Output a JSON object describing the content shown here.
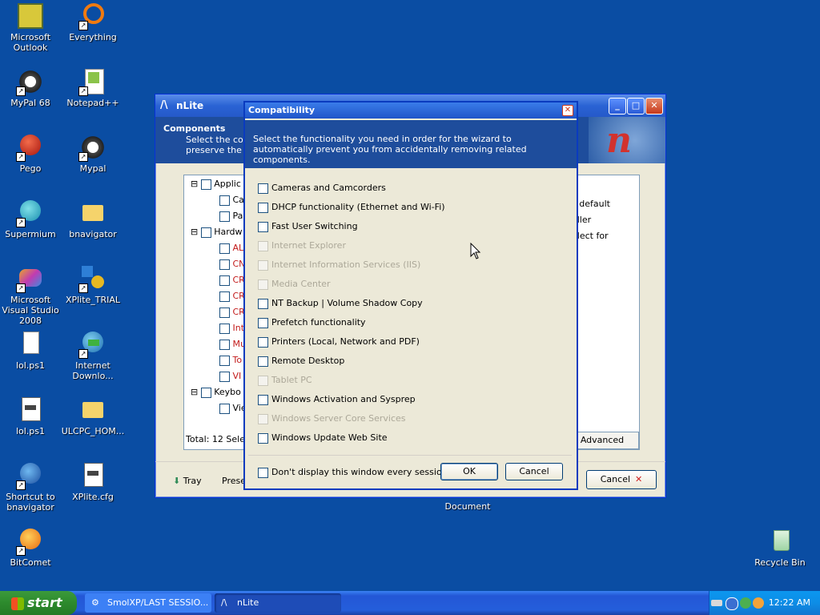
{
  "desktop": {
    "icons": [
      {
        "label": "Microsoft Outlook",
        "icon": "outlook-icon"
      },
      {
        "label": "Everything",
        "icon": "everything-icon"
      },
      {
        "label": "MyPal 68",
        "icon": "mypal-icon"
      },
      {
        "label": "Notepad++",
        "icon": "notepadpp-icon"
      },
      {
        "label": "Pego",
        "icon": "pego-icon"
      },
      {
        "label": "Mypal",
        "icon": "mypal-icon"
      },
      {
        "label": "Supermium",
        "icon": "supermium-icon"
      },
      {
        "label": "bnavigator",
        "icon": "folder-icon"
      },
      {
        "label": "Microsoft Visual Studio 2008",
        "icon": "visual-studio-icon"
      },
      {
        "label": "XPlite_TRIAL",
        "icon": "xplite-icon"
      },
      {
        "label": "lol.ps1",
        "icon": "text-file-icon"
      },
      {
        "label": "Internet Downlo...",
        "icon": "idm-icon"
      },
      {
        "label": "lol.ps1",
        "icon": "script-file-icon"
      },
      {
        "label": "ULCPC_HOM...",
        "icon": "folder-icon"
      },
      {
        "label": "Shortcut to bnavigator",
        "icon": "globe-icon"
      },
      {
        "label": "XPlite.cfg",
        "icon": "config-file-icon"
      },
      {
        "label": "BitComet",
        "icon": "bitcomet-icon"
      },
      {
        "label": "Recycle Bin",
        "icon": "recycle-bin-icon"
      }
    ],
    "hidden_label": "Document"
  },
  "nlite": {
    "title": "nLite",
    "header_title": "Components",
    "header_sub1": "Select the com",
    "header_sub2": "preserve the ch",
    "right_text1": "s default",
    "right_text2": "oller",
    "right_text3": "elect for",
    "tree": [
      {
        "label": "Applic"
      },
      {
        "label": "Ca"
      },
      {
        "label": "Pa"
      },
      {
        "label": "Hardw"
      },
      {
        "label": "AL"
      },
      {
        "label": "CN"
      },
      {
        "label": "CR"
      },
      {
        "label": "CR"
      },
      {
        "label": "CR"
      },
      {
        "label": "Int"
      },
      {
        "label": "Mu"
      },
      {
        "label": "To"
      },
      {
        "label": "VI"
      },
      {
        "label": "Keybo"
      },
      {
        "label": "Vie"
      }
    ],
    "status": "Total: 12 Selec",
    "advanced_label": "Advanced",
    "tray_label": "Tray",
    "presets_label": "Prese",
    "cancel_label": "Cancel"
  },
  "dialog": {
    "title": "Compatibility",
    "description": "Select the functionality you need in order for the wizard to automatically prevent you from accidentally removing related components.",
    "options": [
      {
        "label": "Cameras and Camcorders",
        "enabled": true,
        "checked": false
      },
      {
        "label": "DHCP functionality (Ethernet and Wi-Fi)",
        "enabled": true,
        "checked": false
      },
      {
        "label": "Fast User Switching",
        "enabled": true,
        "checked": false
      },
      {
        "label": "Internet Explorer",
        "enabled": false,
        "checked": false
      },
      {
        "label": "Internet Information Services (IIS)",
        "enabled": false,
        "checked": false
      },
      {
        "label": "Media Center",
        "enabled": false,
        "checked": false
      },
      {
        "label": "NT Backup | Volume Shadow Copy",
        "enabled": true,
        "checked": false
      },
      {
        "label": "Prefetch functionality",
        "enabled": true,
        "checked": false
      },
      {
        "label": "Printers (Local, Network and PDF)",
        "enabled": true,
        "checked": false
      },
      {
        "label": "Remote Desktop",
        "enabled": true,
        "checked": false
      },
      {
        "label": "Tablet PC",
        "enabled": false,
        "checked": false
      },
      {
        "label": "Windows Activation and Sysprep",
        "enabled": true,
        "checked": false
      },
      {
        "label": "Windows Server Core Services",
        "enabled": false,
        "checked": false
      },
      {
        "label": "Windows Update Web Site",
        "enabled": true,
        "checked": false
      }
    ],
    "dont_display_label": "Don't display this window every session",
    "ok_label": "OK",
    "cancel_label": "Cancel"
  },
  "taskbar": {
    "start_label": "start",
    "tasks": [
      {
        "label": "SmolXP/LAST SESSIO..."
      },
      {
        "label": "nLite"
      }
    ],
    "clock": "12:22 AM"
  }
}
